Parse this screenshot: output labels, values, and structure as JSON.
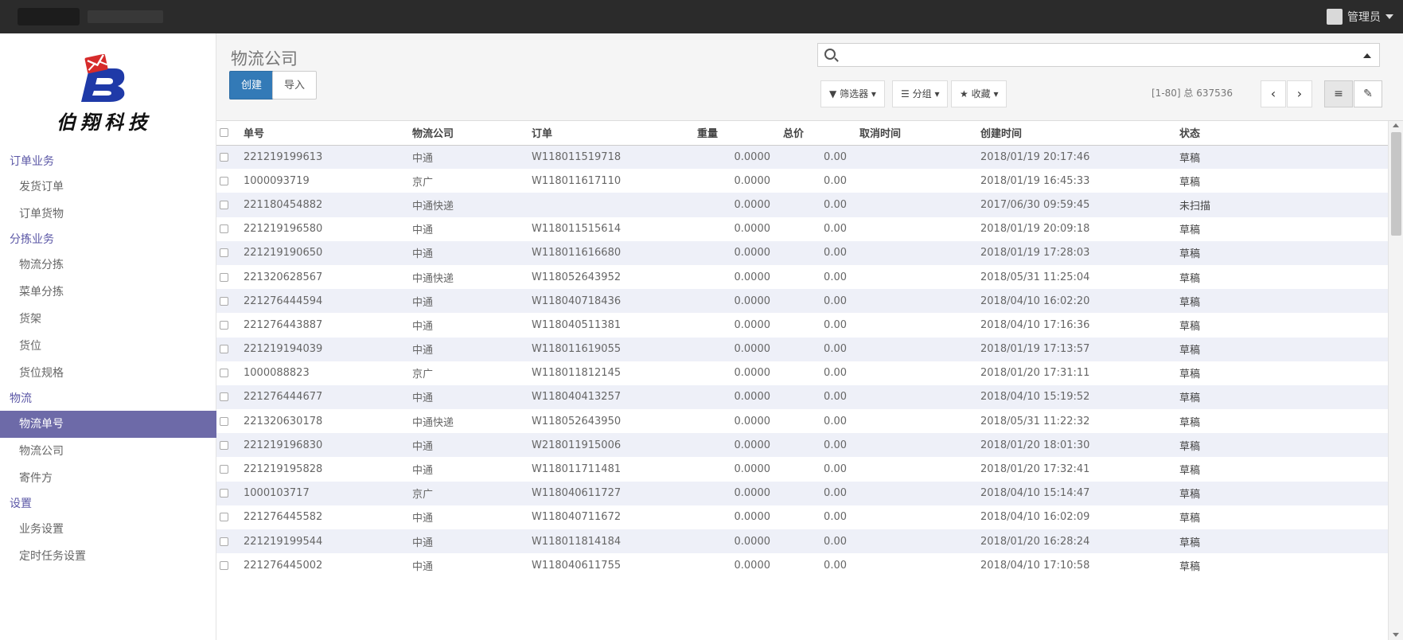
{
  "topbar": {
    "user_name": "管理员"
  },
  "logo": {
    "text": "伯翔科技",
    "colors": {
      "blue": "#1f3aa8",
      "red": "#d62b2b"
    }
  },
  "sidebar": {
    "groups": [
      {
        "label": "订单业务",
        "items": [
          "发货订单",
          "订单货物"
        ]
      },
      {
        "label": "分拣业务",
        "items": [
          "物流分拣",
          "菜单分拣",
          "货架",
          "货位",
          "货位规格"
        ]
      },
      {
        "label": "物流",
        "items": [
          "物流单号",
          "物流公司",
          "寄件方"
        ]
      },
      {
        "label": "设置",
        "items": [
          "业务设置",
          "定时任务设置"
        ]
      }
    ],
    "active_item": "物流单号",
    "active_color": "#6d6aa8"
  },
  "header": {
    "title": "物流公司",
    "create_label": "创建",
    "import_label": "导入",
    "search_value": "",
    "filter_label": "筛选器",
    "group_label": "分组",
    "favorite_label": "收藏",
    "pager_text": "[1-80] 总 637536"
  },
  "table": {
    "columns": [
      "单号",
      "物流公司",
      "订单",
      "重量",
      "总价",
      "取消时间",
      "创建时间",
      "状态"
    ],
    "rows": [
      [
        "221219199613",
        "中通",
        "W118011519718",
        "0.0000",
        "0.00",
        "",
        "2018/01/19 20:17:46",
        "草稿"
      ],
      [
        "1000093719",
        "京广",
        "W118011617110",
        "0.0000",
        "0.00",
        "",
        "2018/01/19 16:45:33",
        "草稿"
      ],
      [
        "221180454882",
        "中通快递",
        "",
        "0.0000",
        "0.00",
        "",
        "2017/06/30 09:59:45",
        "未扫描"
      ],
      [
        "221219196580",
        "中通",
        "W118011515614",
        "0.0000",
        "0.00",
        "",
        "2018/01/19 20:09:18",
        "草稿"
      ],
      [
        "221219190650",
        "中通",
        "W118011616680",
        "0.0000",
        "0.00",
        "",
        "2018/01/19 17:28:03",
        "草稿"
      ],
      [
        "221320628567",
        "中通快递",
        "W118052643952",
        "0.0000",
        "0.00",
        "",
        "2018/05/31 11:25:04",
        "草稿"
      ],
      [
        "221276444594",
        "中通",
        "W118040718436",
        "0.0000",
        "0.00",
        "",
        "2018/04/10 16:02:20",
        "草稿"
      ],
      [
        "221276443887",
        "中通",
        "W118040511381",
        "0.0000",
        "0.00",
        "",
        "2018/04/10 17:16:36",
        "草稿"
      ],
      [
        "221219194039",
        "中通",
        "W118011619055",
        "0.0000",
        "0.00",
        "",
        "2018/01/19 17:13:57",
        "草稿"
      ],
      [
        "1000088823",
        "京广",
        "W118011812145",
        "0.0000",
        "0.00",
        "",
        "2018/01/20 17:31:11",
        "草稿"
      ],
      [
        "221276444677",
        "中通",
        "W118040413257",
        "0.0000",
        "0.00",
        "",
        "2018/04/10 15:19:52",
        "草稿"
      ],
      [
        "221320630178",
        "中通快递",
        "W118052643950",
        "0.0000",
        "0.00",
        "",
        "2018/05/31 11:22:32",
        "草稿"
      ],
      [
        "221219196830",
        "中通",
        "W218011915006",
        "0.0000",
        "0.00",
        "",
        "2018/01/20 18:01:30",
        "草稿"
      ],
      [
        "221219195828",
        "中通",
        "W118011711481",
        "0.0000",
        "0.00",
        "",
        "2018/01/20 17:32:41",
        "草稿"
      ],
      [
        "1000103717",
        "京广",
        "W118040611727",
        "0.0000",
        "0.00",
        "",
        "2018/04/10 15:14:47",
        "草稿"
      ],
      [
        "221276445582",
        "中通",
        "W118040711672",
        "0.0000",
        "0.00",
        "",
        "2018/04/10 16:02:09",
        "草稿"
      ],
      [
        "221219199544",
        "中通",
        "W118011814184",
        "0.0000",
        "0.00",
        "",
        "2018/01/20 16:28:24",
        "草稿"
      ],
      [
        "221276445002",
        "中通",
        "W118040611755",
        "0.0000",
        "0.00",
        "",
        "2018/04/10 17:10:58",
        "草稿"
      ]
    ]
  }
}
